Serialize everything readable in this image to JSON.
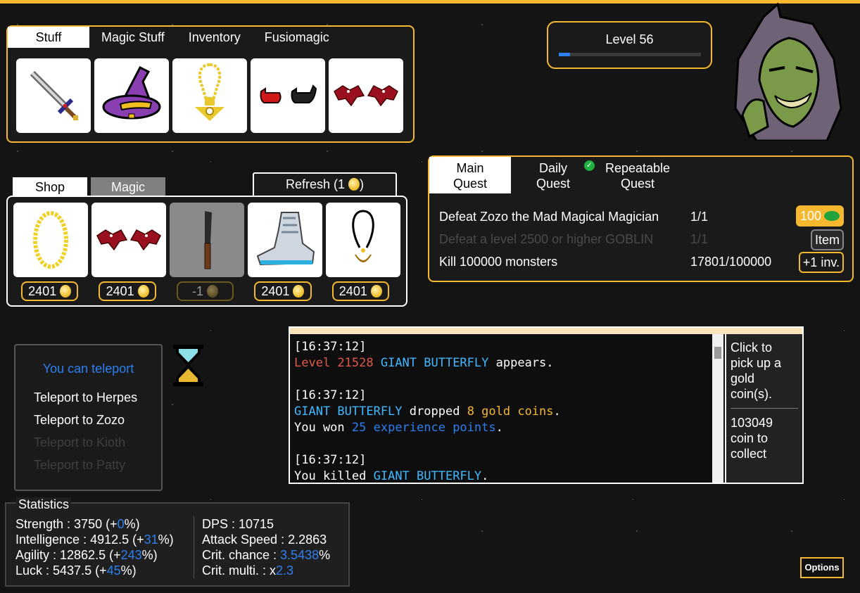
{
  "stuff_tabs": [
    {
      "label": "Stuff",
      "active": true
    },
    {
      "label": "Magic Stuff",
      "active": false
    },
    {
      "label": "Inventory",
      "active": false
    },
    {
      "label": "Fusiomagic",
      "active": false
    }
  ],
  "equipped_items": [
    {
      "icon": "sword-icon"
    },
    {
      "icon": "wizard-hat-icon"
    },
    {
      "icon": "amulet-icon"
    },
    {
      "icon": "boots-icon"
    },
    {
      "icon": "red-bat-icon"
    }
  ],
  "level": {
    "label": "Level 56",
    "xp_fraction": 0.08
  },
  "shop": {
    "tabs": [
      {
        "label": "Shop",
        "active": true
      },
      {
        "label": "Magic",
        "active": false
      }
    ],
    "refresh_label": "Refresh (1",
    "refresh_suffix": ")",
    "items": [
      {
        "icon": "golden-ring-icon",
        "price": "2401",
        "available": true
      },
      {
        "icon": "red-bat-icon",
        "price": "2401",
        "available": true
      },
      {
        "icon": "knife-icon",
        "price": "-1",
        "available": false
      },
      {
        "icon": "sneaker-icon",
        "price": "2401",
        "available": true
      },
      {
        "icon": "necklace-icon",
        "price": "2401",
        "available": true
      }
    ]
  },
  "quests": {
    "tabs": [
      {
        "line1": "Main",
        "line2": "Quest",
        "active": true
      },
      {
        "line1": "Daily",
        "line2": "Quest",
        "active": false,
        "completed": true
      },
      {
        "line1": "Repeatable",
        "line2": "Quest",
        "active": false
      }
    ],
    "rows": [
      {
        "name": "Defeat Zozo the Mad Magical Magician",
        "progress": "1/1",
        "button": "100",
        "button_type": "reward",
        "dim": false
      },
      {
        "name": "Defeat a level 2500 or higher GOBLIN",
        "progress": "1/1",
        "button": "Item",
        "button_type": "item",
        "dim": true
      },
      {
        "name": "Kill 100000 monsters",
        "progress": "17801/100000",
        "button": "+1 inv.",
        "button_type": "plain",
        "dim": false
      }
    ]
  },
  "teleport": {
    "heading": "You can teleport",
    "options": [
      {
        "label": "Teleport to Herpes",
        "enabled": true
      },
      {
        "label": "Teleport to Zozo",
        "enabled": true
      },
      {
        "label": "Teleport to Kioth",
        "enabled": false
      },
      {
        "label": "Teleport to Patty",
        "enabled": false
      }
    ]
  },
  "log": {
    "t1": "[16:37:12]",
    "l1a": "Level 21528",
    "l1b": "GIANT BUTTERFLY",
    "l1c": "appears.",
    "t2": "[16:37:12]",
    "l2a": "GIANT BUTTERFLY",
    "l2b": "dropped",
    "l2c": "8 gold coins",
    "l2d": ".",
    "l3a": "You won",
    "l3b": "25 experience points",
    "l3c": ".",
    "t3": "[16:37:12]",
    "l4a": "You killed",
    "l4b": "GIANT BUTTERFLY",
    "l4c": "."
  },
  "collector": {
    "hint": "Click to pick up a gold coin(s).",
    "amount": "103049",
    "amount_label": "coin to collect"
  },
  "stats": {
    "title": "Statistics",
    "strength": {
      "label": "Strength : 3750 (+",
      "bonus": "0",
      "suffix": "%)"
    },
    "intelligence": {
      "label": "Intelligence : 4912.5 (+",
      "bonus": "31",
      "suffix": "%)"
    },
    "agility": {
      "label": "Agility : 12862.5 (+",
      "bonus": "243",
      "suffix": "%)"
    },
    "luck": {
      "label": "Luck : 5437.5 (+",
      "bonus": "45",
      "suffix": "%)"
    },
    "dps": "DPS : 10715",
    "attack_speed": "Attack Speed : 2.2863",
    "crit_chance": {
      "label": "Crit. chance : ",
      "value": "3.5438",
      "suffix": "%"
    },
    "crit_multi": {
      "label": "Crit. multi. : x",
      "value": "2.3"
    }
  },
  "options_label": "Options",
  "colors": {
    "accent": "#f5b82f",
    "highlight": "#2d7ff0",
    "cyan": "#40b8ff",
    "red": "#e05a4a"
  }
}
